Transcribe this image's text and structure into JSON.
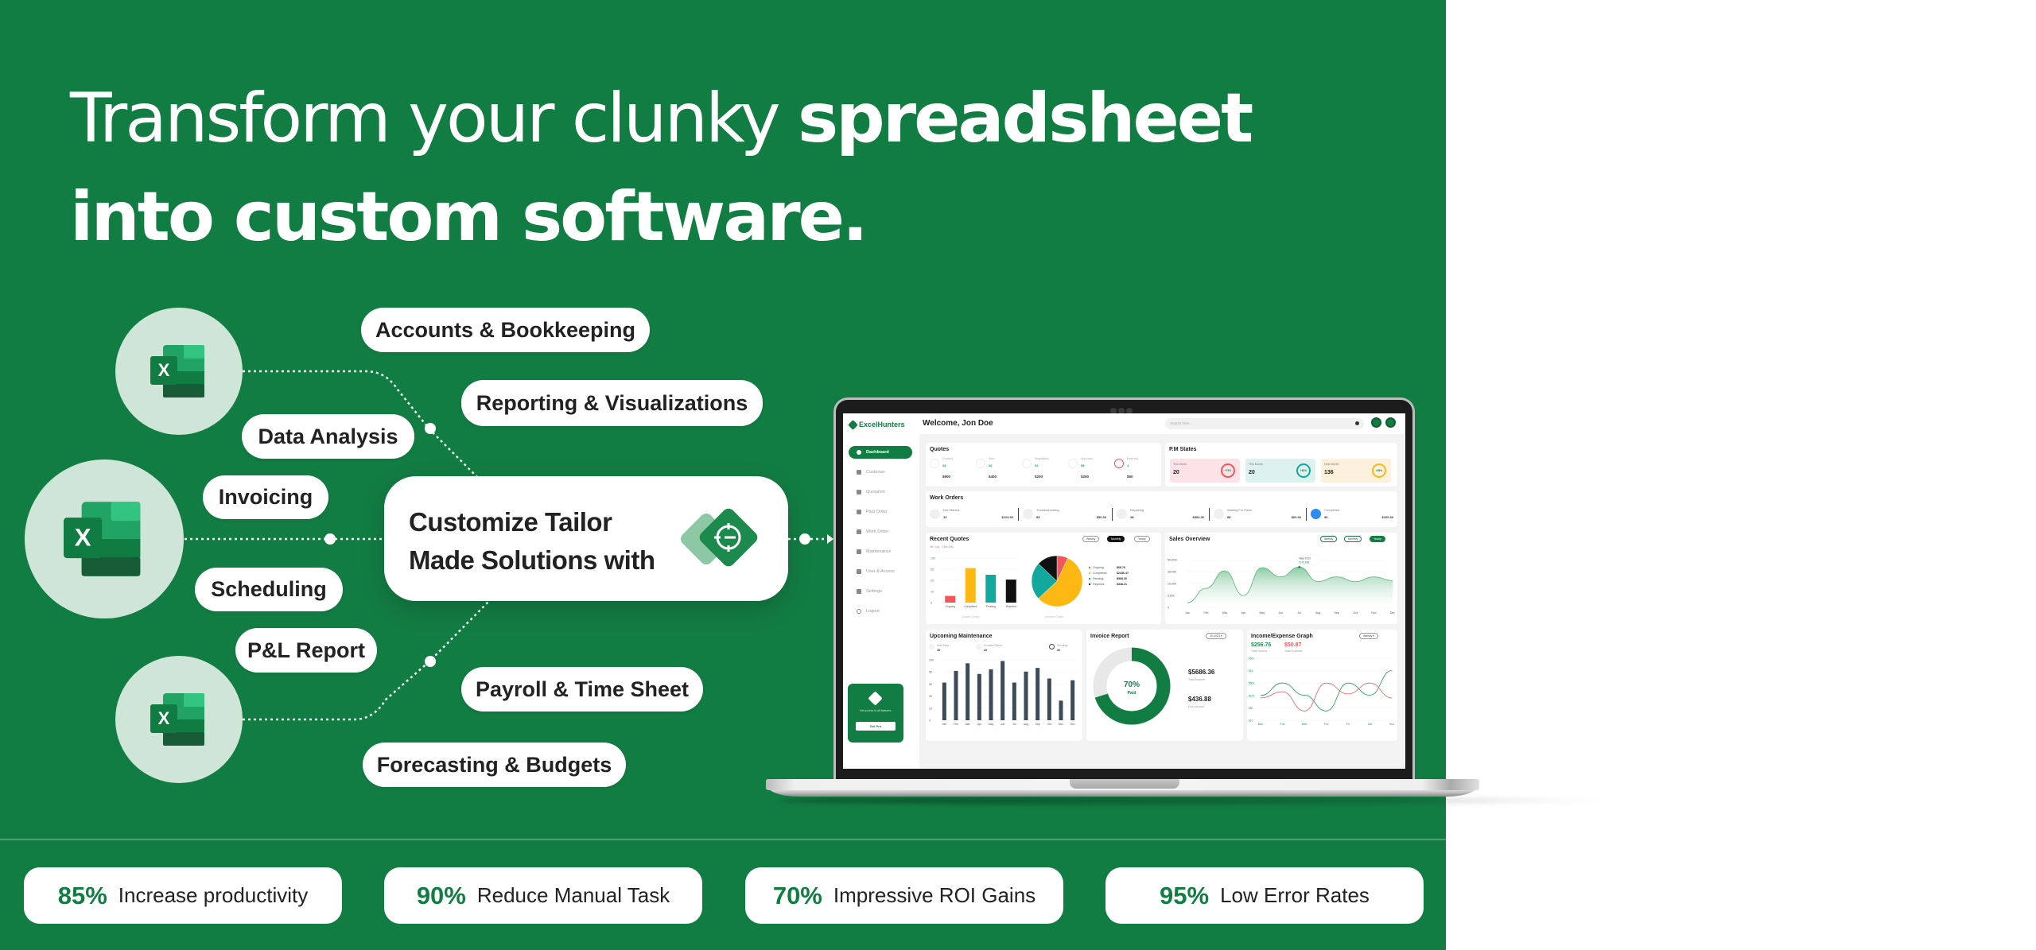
{
  "headline": {
    "line1_light": "Transform your clunky ",
    "line1_bold": "spreadsheet",
    "line2_bold": "into custom software."
  },
  "diagram": {
    "excel_icon_label": "X",
    "features": [
      "Accounts & Bookkeeping",
      "Reporting & Visualizations",
      "Data Analysis",
      "Invoicing",
      "Scheduling",
      "P&L Report",
      "Payroll & Time Sheet",
      "Forecasting & Budgets"
    ],
    "center_card": {
      "line1": "Customize Tailor",
      "line2": "Made Solutions with"
    }
  },
  "stats": [
    {
      "value": "85%",
      "label": "Increase productivity"
    },
    {
      "value": "90%",
      "label": "Reduce Manual Task"
    },
    {
      "value": "70%",
      "label": "Impressive ROI Gains"
    },
    {
      "value": "95%",
      "label": "Low Error Rates"
    }
  ],
  "colors": {
    "brand_green": "#127d43",
    "light_green": "#cfe5d8",
    "expense_red": "#f0575c",
    "completed_yellow": "#fdb813",
    "pending_teal": "#13a89e"
  },
  "dashboard": {
    "brand": "ExcelHunters",
    "welcome": "Welcome, Jon Doe",
    "search_placeholder": "Search here...",
    "sidebar": [
      {
        "label": "Dashboard",
        "active": true
      },
      {
        "label": "Customer"
      },
      {
        "label": "Quotation"
      },
      {
        "label": "Past Order"
      },
      {
        "label": "Work Order"
      },
      {
        "label": "Maintenance"
      },
      {
        "label": "User & Access"
      },
      {
        "label": "Settings"
      },
      {
        "label": "Logout"
      }
    ],
    "get_pro": {
      "text": "Get access to all features.",
      "button": "Get Pro"
    },
    "quotes": {
      "title": "Quotes",
      "items": [
        {
          "label": "Created",
          "count": "28",
          "amount": "$900"
        },
        {
          "label": "Sent",
          "count": "20",
          "amount": "$400"
        },
        {
          "label": "Negotiation",
          "count": "02",
          "amount": "$200"
        },
        {
          "label": "Approved",
          "count": "05",
          "amount": "$250"
        },
        {
          "label": "Rejected",
          "count": "1",
          "amount": "$50"
        }
      ]
    },
    "pm_states": {
      "title": "P.M States",
      "items": [
        {
          "label": "This Week",
          "value": "20",
          "change": "+74%"
        },
        {
          "label": "This Month",
          "value": "20",
          "change": "+63%"
        },
        {
          "label": "Next Month",
          "value": "136",
          "change": "+85%"
        }
      ]
    },
    "work_orders": {
      "title": "Work Orders",
      "items": [
        {
          "label": "Not Started",
          "count": "12",
          "amount": "$124.36"
        },
        {
          "label": "Troubleshooting",
          "count": "05",
          "amount": "$50.36"
        },
        {
          "label": "Repairing",
          "count": "18",
          "amount": "$500.36"
        },
        {
          "label": "Waiting For Parts",
          "count": "08",
          "amount": "$60.36"
        },
        {
          "label": "Completed",
          "count": "30",
          "amount": "$100.36"
        }
      ]
    },
    "recent_quotes": {
      "title": "Recent Quotes",
      "date_range": "9th July - 16th July",
      "toggles": [
        "Weekly",
        "Monthly",
        "Yearly"
      ],
      "active_toggle": "Monthly",
      "bar_caption": "Quotes Graph",
      "pie_caption": "Amount Graph",
      "pie_legend": [
        {
          "label": "Ongoing:",
          "value": "$68.76"
        },
        {
          "label": "Completed:",
          "value": "$2456.47"
        },
        {
          "label": "Pending:",
          "value": "$568.30"
        },
        {
          "label": "Rejected:",
          "value": "$348.21"
        }
      ]
    },
    "sales_overview": {
      "title": "Sales Overview",
      "toggles": [
        "Weekly",
        "Monthly",
        "Yearly"
      ],
      "active_toggle": "Yearly",
      "tooltip_label": "May-2023",
      "tooltip_value": "$ 40,698"
    },
    "upcoming_maintenance": {
      "title": "Upcoming Maintenance",
      "stats": [
        {
          "label": "Mail Sent",
          "value": "35"
        },
        {
          "label": "Contact Client",
          "value": "25"
        },
        {
          "label": "Pending",
          "value": "30"
        }
      ]
    },
    "invoice_report": {
      "title": "Invoice Report",
      "period": "20-2023",
      "paid_pct_label": "70%",
      "paid_label": "Paid",
      "total_amount": "$5686.36",
      "total_amount_label": "Total Amount",
      "due_amount": "$436.88",
      "due_amount_label": "Due Amount"
    },
    "income_expense": {
      "title": "Income/Expense Graph",
      "period": "Weekly",
      "income": "$256.76",
      "income_label": "Total Income",
      "expense": "$50.87",
      "expense_label": "Total Expense"
    }
  },
  "chart_data": [
    {
      "type": "bar",
      "title": "Quotes Graph",
      "categories": [
        "Ongoing",
        "Completed",
        "Pending",
        "Rejected"
      ],
      "values": [
        6,
        55,
        35,
        22
      ],
      "yticks": [
        "0",
        "10",
        "20",
        "50",
        "100"
      ],
      "colors": [
        "#f0575c",
        "#fdb813",
        "#13a89e",
        "#111111"
      ]
    },
    {
      "type": "pie",
      "title": "Amount Graph",
      "labels": [
        "Ongoing",
        "Completed",
        "Pending",
        "Rejected"
      ],
      "values": [
        7,
        56,
        24,
        13
      ],
      "colors": [
        "#f0575c",
        "#fdb813",
        "#13a89e",
        "#111111"
      ]
    },
    {
      "type": "area",
      "title": "Sales Overview",
      "x": [
        "Jan",
        "Feb",
        "Mar",
        "Apr",
        "May",
        "Jun",
        "Jul",
        "Aug",
        "Sep",
        "Oct",
        "Nov",
        "Dec"
      ],
      "values": [
        2000,
        8000,
        36000,
        5000,
        40000,
        24000,
        40698,
        14000,
        24000,
        14000,
        24000,
        16000
      ],
      "yticks": [
        "0",
        "5,000",
        "10,000",
        "35,000",
        "50,000+"
      ]
    },
    {
      "type": "bar",
      "title": "Upcoming Maintenance",
      "categories": [
        "Jan",
        "Feb",
        "Mar",
        "Apr",
        "May",
        "Jun",
        "Jul",
        "Aug",
        "Sep",
        "Oct",
        "Nov",
        "Dec"
      ],
      "values": [
        32,
        55,
        88,
        47,
        62,
        98,
        32,
        52,
        68,
        39,
        15,
        36
      ],
      "yticks": [
        "0",
        "10",
        "20",
        "30",
        "50",
        "100"
      ]
    },
    {
      "type": "pie",
      "title": "Invoice Report",
      "labels": [
        "Paid",
        "Due"
      ],
      "values": [
        70,
        30
      ]
    },
    {
      "type": "line",
      "title": "Income/Expense Graph",
      "x": [
        "Mon",
        "Tue",
        "Wed",
        "Thu",
        "Fri",
        "Sat",
        "Sun"
      ],
      "yticks": [
        "$10",
        "$50",
        "$100",
        "$500",
        "$1K",
        "$5K+"
      ],
      "series": [
        {
          "name": "Income",
          "color": "#1a9a50",
          "values": [
            100,
            500,
            110,
            40,
            500,
            110,
            1000
          ]
        },
        {
          "name": "Expense",
          "color": "#f0575c",
          "values": [
            90,
            220,
            40,
            500,
            150,
            500,
            90
          ]
        }
      ]
    }
  ]
}
